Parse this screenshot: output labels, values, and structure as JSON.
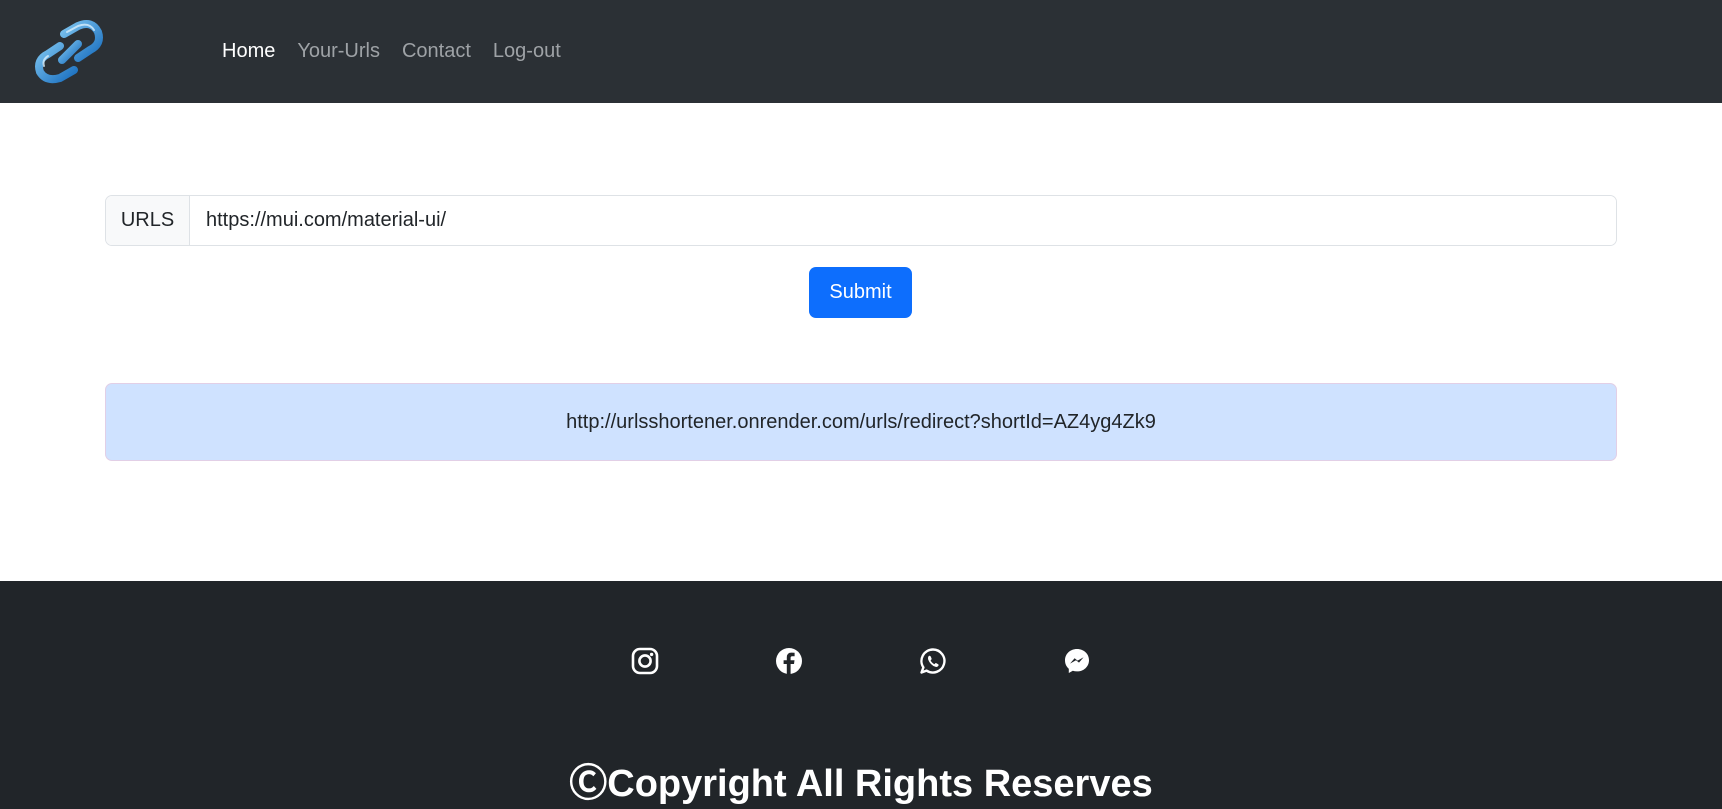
{
  "navbar": {
    "logo_icon": "chain-link-icon",
    "links": [
      {
        "label": "Home",
        "active": true
      },
      {
        "label": "Your-Urls",
        "active": false
      },
      {
        "label": "Contact",
        "active": false
      },
      {
        "label": "Log-out",
        "active": false
      }
    ]
  },
  "form": {
    "input_label": "URLS",
    "url_value": "https://mui.com/material-ui/",
    "submit_label": "Submit"
  },
  "result": {
    "short_url": "http://urlsshortener.onrender.com/urls/redirect?shortId=AZ4yg4Zk9"
  },
  "footer": {
    "social_icons": [
      "instagram-icon",
      "facebook-icon",
      "whatsapp-icon",
      "messenger-icon"
    ],
    "copyright": "ⒸCopyright All Rights Reserves"
  },
  "colors": {
    "navbar_bg": "#2b3035",
    "footer_bg": "#212529",
    "primary": "#0d6efd",
    "alert_bg": "#cfe2ff"
  }
}
